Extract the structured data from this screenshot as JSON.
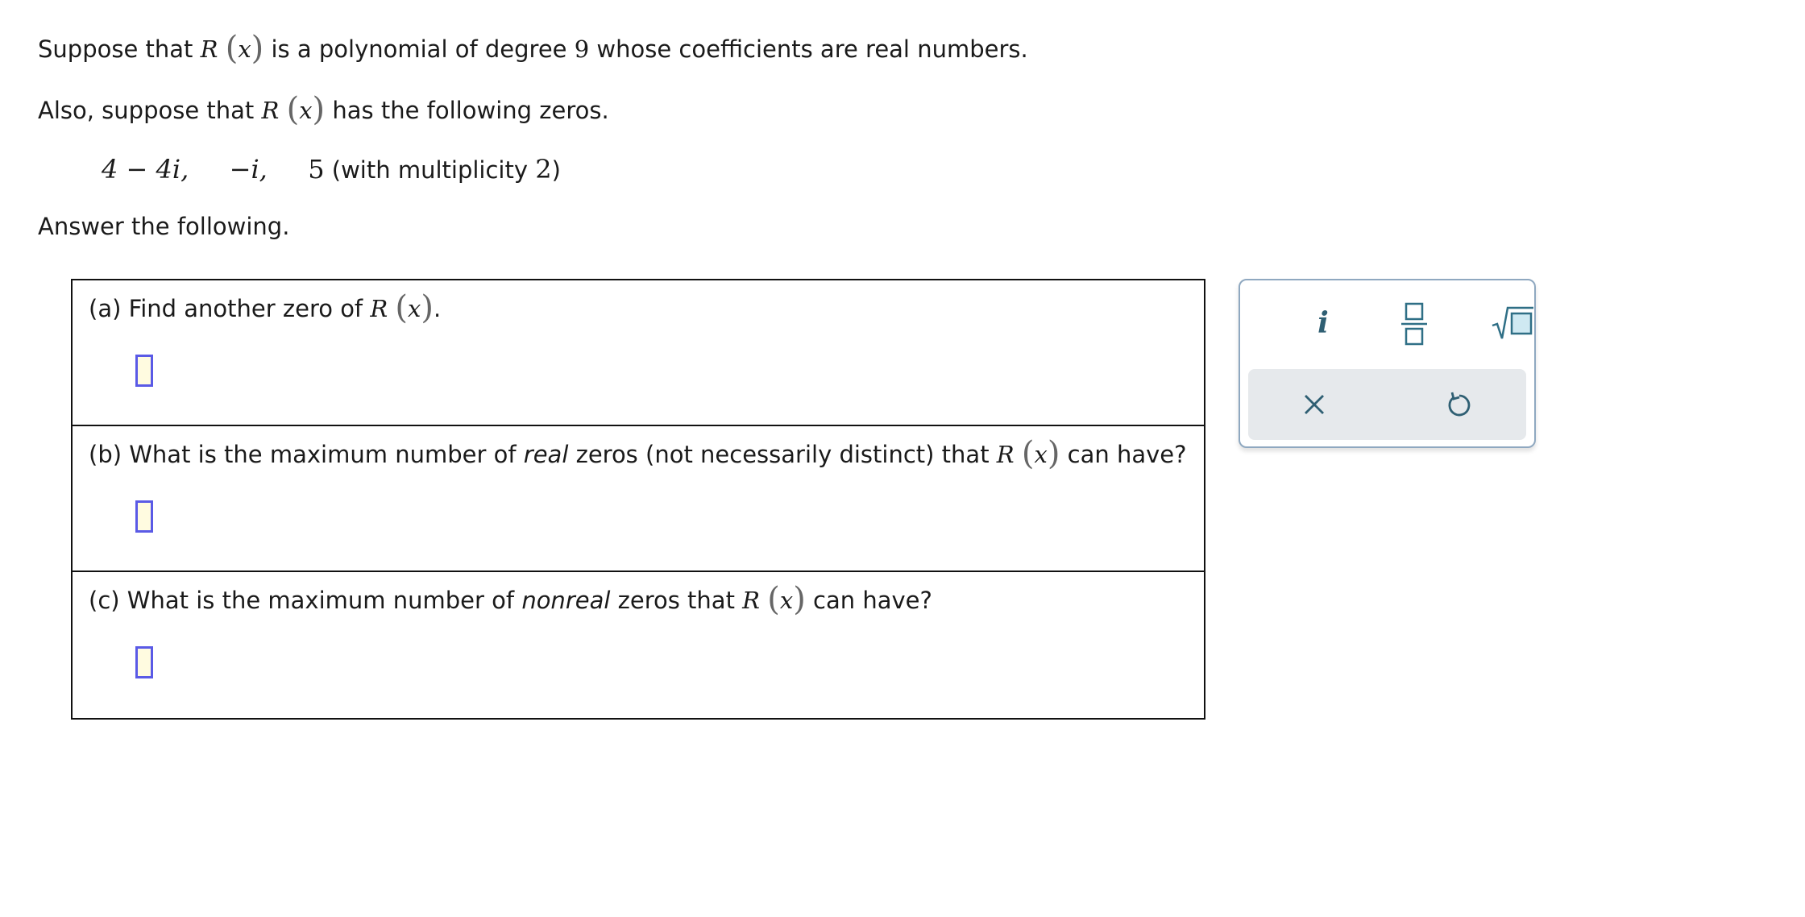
{
  "intro": {
    "line1_a": "Suppose that ",
    "line1_fn": "R",
    "line1_var": "x",
    "line1_b": " is a polynomial of degree ",
    "line1_degree": "9",
    "line1_c": " whose coefficients are real numbers.",
    "line2_a": "Also, suppose that ",
    "line2_fn": "R",
    "line2_var": "x",
    "line2_b": " has the following zeros.",
    "zero1": "4 − 4i,",
    "zero2": "−i,",
    "zero3": "5",
    "zero3_note_a": " (with multiplicity ",
    "zero3_mult": "2",
    "zero3_note_b": ")",
    "line3": "Answer the following."
  },
  "questions": [
    {
      "prefix": "(a) Find another zero of ",
      "fn": "R",
      "var": "x",
      "suffix": ".",
      "answer": ""
    },
    {
      "prefix": "(b) What is the maximum number of ",
      "emph": "real",
      "mid": " zeros (not necessarily distinct) that ",
      "fn": "R",
      "var": "x",
      "suffix": " can have?",
      "answer": ""
    },
    {
      "prefix": "(c) What is the maximum number of ",
      "emph": "nonreal",
      "mid": " zeros that ",
      "fn": "R",
      "var": "x",
      "suffix": " can have?",
      "answer": ""
    }
  ],
  "toolbar": {
    "imaginary_label": "i",
    "icons": [
      "fraction-icon",
      "square-root-icon",
      "clear-icon",
      "undo-icon"
    ],
    "icon_color": "#2f6f86",
    "box_fill": "#cfe9f2"
  },
  "colors": {
    "answer_border": "#5a5ae6",
    "answer_fill": "#fffbe0",
    "toolbar_border": "#8fa8c0",
    "toolbar_bottom_bg": "#e6e9ec"
  }
}
